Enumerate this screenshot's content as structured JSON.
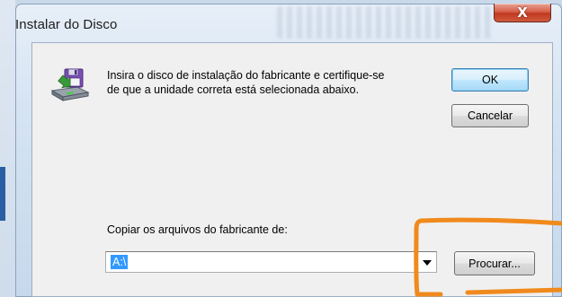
{
  "window": {
    "title": "Instalar do Disco",
    "close_glyph": "X"
  },
  "dialog": {
    "message": "Insira o disco de instalação do fabricante e certifique-se\nde que a unidade correta está selecionada abaixo.",
    "ok_label": "OK",
    "cancel_label": "Cancelar",
    "copy_label": "Copiar os arquivos do fabricante de:",
    "path_value": "A:\\",
    "browse_label": "Procurar..."
  },
  "icons": {
    "disk": "floppy-disk-install-icon",
    "dropdown": "chevron-down-icon"
  },
  "colors": {
    "highlight": "#f08a1c",
    "selection": "#3399ff",
    "close_button": "#c1391f"
  }
}
